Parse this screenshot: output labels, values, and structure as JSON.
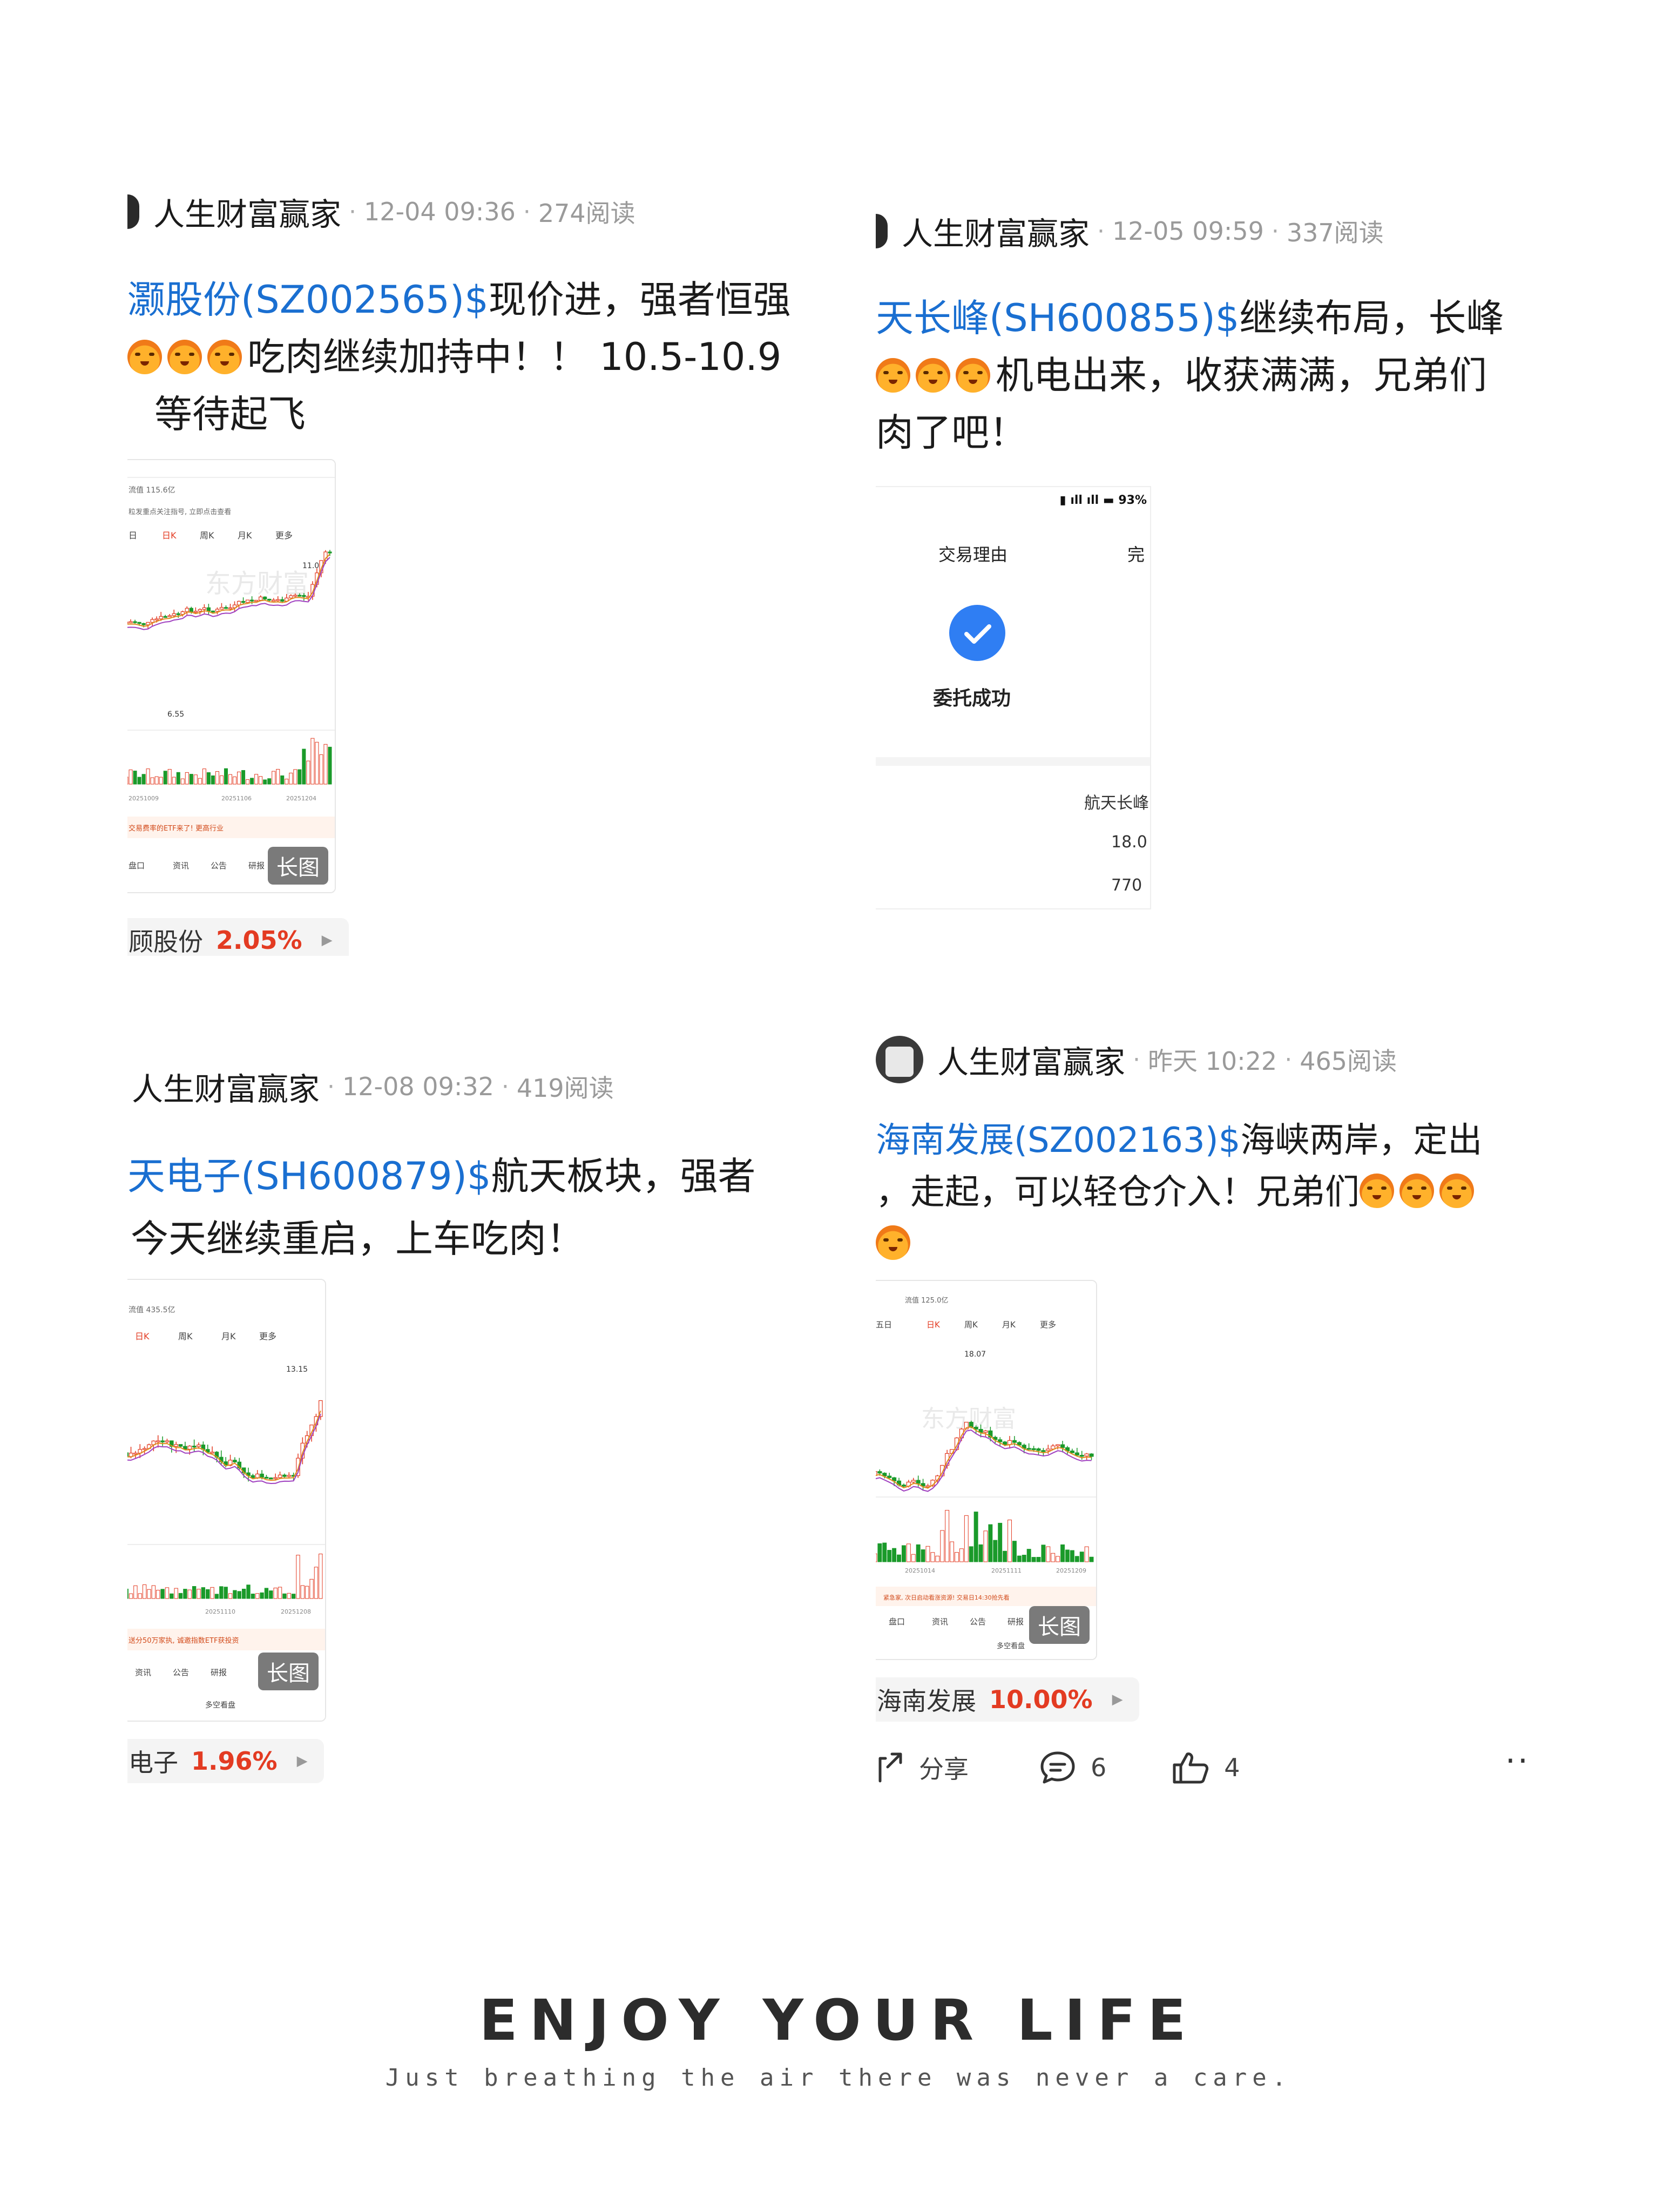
{
  "posts": [
    {
      "author": "人生财富赢家",
      "time": "12-04 09:36",
      "reads": "274阅读",
      "stock": "灏股份(SZ002565)$",
      "text1": "现价进，强者恒强",
      "line2": "吃肉继续加持中！！ 10.5-10.9",
      "line3": "等待起飞",
      "long_image_label": "长图",
      "quote_name": "顾股份",
      "quote_pct": "2.05%"
    },
    {
      "author": "人生财富赢家",
      "time": "12-05 09:59",
      "reads": "337阅读",
      "stock": "天长峰(SH600855)$",
      "text1": "继续布局，长峰",
      "line2": "机电出来，收获满满，兄弟们",
      "line3": "肉了吧！",
      "trade": {
        "battery": "93%",
        "reason_label": "交易理由",
        "tab2": "完",
        "success_text": "委托成功",
        "stock_name": "航天长峰",
        "price": "18.0",
        "volume": "770"
      }
    },
    {
      "author": "人生财富赢家",
      "time": "12-08 09:32",
      "reads": "419阅读",
      "stock": "天电子(SH600879)$",
      "text1": "航天板块，强者",
      "line2": "今天继续重启，上车吃肉！",
      "long_image_label": "长图",
      "quote_name": "电子",
      "quote_pct": "1.96%"
    },
    {
      "author": "人生财富赢家",
      "time": "昨天 10:22",
      "reads": "465阅读",
      "stock": "海南发展(SZ002163)$",
      "text1": "海峡两岸，定出",
      "line2": "，走起，可以轻仓介入！兄弟们",
      "long_image_label": "长图",
      "quote_name": "海南发展",
      "quote_pct": "10.00%",
      "share_label": "分享",
      "comment_count": "6",
      "like_count": "4",
      "more_label": "··"
    }
  ],
  "chart_labels": {
    "p1": {
      "tabs": [
        "日",
        "日K",
        "周K",
        "月K",
        "更多"
      ],
      "dates": [
        "20251009",
        "20251106",
        "20251204"
      ],
      "ad": "交易费率的ETF来了! 更高行业",
      "nav": [
        "盘口",
        "资讯",
        "公告",
        "研报"
      ],
      "price_top": "11.00",
      "price_low": "6.55",
      "info1": "流值 115.6亿",
      "info2": "粒发重点关注指号, 立即点击查看"
    },
    "p3": {
      "tabs": [
        "日K",
        "周K",
        "月K",
        "更多"
      ],
      "dates": [
        "20251110",
        "20251208"
      ],
      "ad": "送分50万家执, 诚邀指数ETF获投资",
      "nav": [
        "资讯",
        "公告",
        "研报"
      ],
      "price_top": "13.15",
      "info1": "流值 435.5亿",
      "footer": "多空看盘"
    },
    "p4": {
      "tabs": [
        "五日",
        "日K",
        "周K",
        "月K",
        "更多"
      ],
      "dates": [
        "20251014",
        "20251111",
        "20251209"
      ],
      "ad": "紧急家, 次日启动看涨资源! 交易日14:30抢先看",
      "nav": [
        "盘口",
        "资讯",
        "公告",
        "研报"
      ],
      "price_top": "18.07",
      "info1": "流值 125.0亿",
      "footer": "多空看盘"
    }
  },
  "footer": {
    "title": "ENJOY YOUR LIFE",
    "subtitle": "Just breathing the air there was never a care."
  },
  "colors": {
    "link": "#1a6fd1",
    "up_red": "#e33b22",
    "down_green": "#1a9a2a",
    "meta_gray": "#9a9a9a"
  }
}
